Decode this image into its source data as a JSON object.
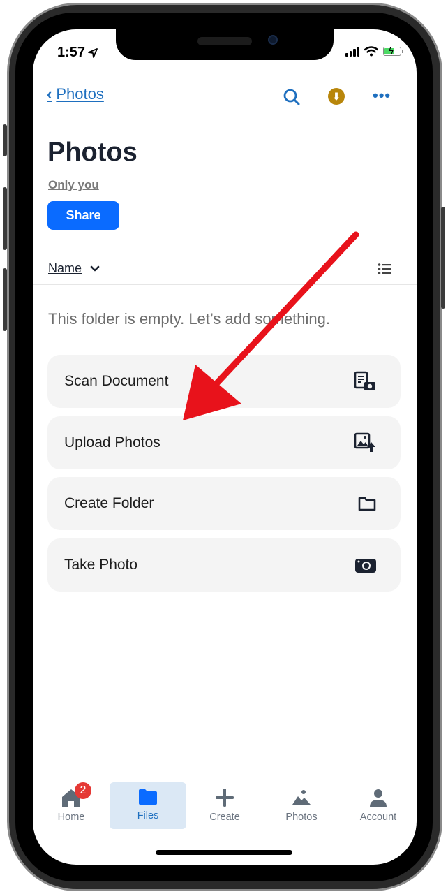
{
  "status_bar": {
    "time": "1:57",
    "location_icon": "location-arrow-icon",
    "signal_icon": "signal-bars-icon",
    "wifi_icon": "wifi-icon",
    "battery_icon": "battery-charging-icon"
  },
  "nav": {
    "back_label": "Photos",
    "back_icon": "chevron-left-icon",
    "search_icon": "search-icon",
    "download_icon": "download-icon",
    "more_icon": "more-icon",
    "more_glyph": "•••",
    "download_glyph": "⬇"
  },
  "header": {
    "title": "Photos",
    "sharing_label": "Only you",
    "share_button": "Share"
  },
  "sort": {
    "label": "Name",
    "chevron_icon": "chevron-down-icon",
    "view_toggle_icon": "list-view-icon"
  },
  "empty_message": "This folder is empty. Let’s add something.",
  "actions": [
    {
      "label": "Scan Document",
      "icon": "scan-document-icon"
    },
    {
      "label": "Upload Photos",
      "icon": "upload-photo-icon"
    },
    {
      "label": "Create Folder",
      "icon": "folder-icon"
    },
    {
      "label": "Take Photo",
      "icon": "camera-icon"
    }
  ],
  "tabbar": [
    {
      "label": "Home",
      "icon": "home-icon",
      "badge": "2",
      "active": false
    },
    {
      "label": "Files",
      "icon": "folder-icon",
      "active": true
    },
    {
      "label": "Create",
      "icon": "plus-icon",
      "active": false
    },
    {
      "label": "Photos",
      "icon": "photos-icon",
      "active": false
    },
    {
      "label": "Account",
      "icon": "account-icon",
      "active": false
    }
  ],
  "annotation": {
    "type": "arrow",
    "color": "#e8121b",
    "points_to": "Upload Photos"
  },
  "colors": {
    "accent": "#0a6bff",
    "link": "#1e6fbf",
    "download_badge": "#b8860b",
    "notification_badge": "#e53935",
    "active_tab_bg": "#dbe8f5"
  }
}
